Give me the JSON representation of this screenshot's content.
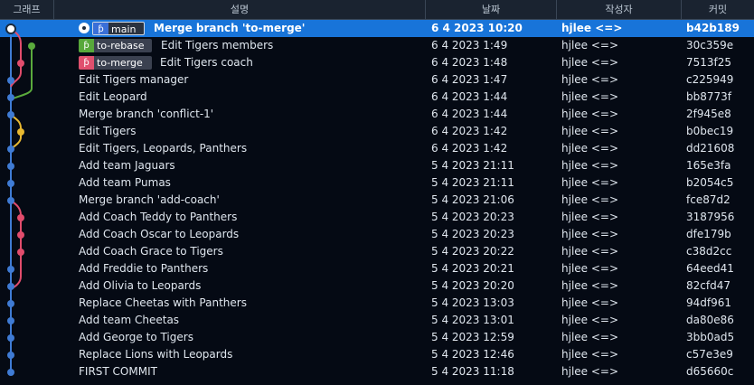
{
  "columns": {
    "graph": "그래프",
    "message": "설명",
    "date": "날짜",
    "author": "작성자",
    "commit": "커밋"
  },
  "branch_tags": {
    "main": "main",
    "to_rebase": "to-rebase",
    "to_merge": "to-merge"
  },
  "colors": {
    "lane_main": "#3f7bd4",
    "lane_rebase": "#5aaa3c",
    "lane_merge": "#e14c6c",
    "lane_conflict": "#e8b830",
    "selected_row": "#1874d9",
    "background": "#050a14"
  },
  "commits": [
    {
      "message": "Merge branch 'to-merge'",
      "date": "6 4 2023 10:20",
      "author": "hjlee <=>",
      "commit": "b42b189"
    },
    {
      "message": "Edit Tigers members",
      "date": "6 4 2023 1:49",
      "author": "hjlee <=>",
      "commit": "30c359e"
    },
    {
      "message": "Edit Tigers coach",
      "date": "6 4 2023 1:48",
      "author": "hjlee <=>",
      "commit": "7513f25"
    },
    {
      "message": "Edit Tigers manager",
      "date": "6 4 2023 1:47",
      "author": "hjlee <=>",
      "commit": "c225949"
    },
    {
      "message": "Edit Leopard",
      "date": "6 4 2023 1:44",
      "author": "hjlee <=>",
      "commit": "bb8773f"
    },
    {
      "message": "Merge branch 'conflict-1'",
      "date": "6 4 2023 1:44",
      "author": "hjlee <=>",
      "commit": "2f945e8"
    },
    {
      "message": "Edit Tigers",
      "date": "6 4 2023 1:42",
      "author": "hjlee <=>",
      "commit": "b0bec19"
    },
    {
      "message": "Edit Tigers, Leopards, Panthers",
      "date": "6 4 2023 1:42",
      "author": "hjlee <=>",
      "commit": "dd21608"
    },
    {
      "message": "Add team Jaguars",
      "date": "5 4 2023 21:11",
      "author": "hjlee <=>",
      "commit": "165e3fa"
    },
    {
      "message": "Add team Pumas",
      "date": "5 4 2023 21:11",
      "author": "hjlee <=>",
      "commit": "b2054c5"
    },
    {
      "message": "Merge branch 'add-coach'",
      "date": "5 4 2023 21:06",
      "author": "hjlee <=>",
      "commit": "fce87d2"
    },
    {
      "message": "Add Coach Teddy to Panthers",
      "date": "5 4 2023 20:23",
      "author": "hjlee <=>",
      "commit": "3187956"
    },
    {
      "message": "Add Coach Oscar to Leopards",
      "date": "5 4 2023 20:23",
      "author": "hjlee <=>",
      "commit": "dfe179b"
    },
    {
      "message": "Add Coach Grace to Tigers",
      "date": "5 4 2023 20:22",
      "author": "hjlee <=>",
      "commit": "c38d2cc"
    },
    {
      "message": "Add Freddie to Panthers",
      "date": "5 4 2023 20:21",
      "author": "hjlee <=>",
      "commit": "64eed41"
    },
    {
      "message": "Add Olivia to Leopards",
      "date": "5 4 2023 20:20",
      "author": "hjlee <=>",
      "commit": "82cfd47"
    },
    {
      "message": "Replace Cheetas with Panthers",
      "date": "5 4 2023 13:03",
      "author": "hjlee <=>",
      "commit": "94df961"
    },
    {
      "message": "Add team Cheetas",
      "date": "5 4 2023 13:01",
      "author": "hjlee <=>",
      "commit": "da80e86"
    },
    {
      "message": "Add George to Tigers",
      "date": "5 4 2023 12:59",
      "author": "hjlee <=>",
      "commit": "3bb0ad5"
    },
    {
      "message": "Replace Lions with Leopards",
      "date": "5 4 2023 12:46",
      "author": "hjlee <=>",
      "commit": "c57e3e9"
    },
    {
      "message": "FIRST COMMIT",
      "date": "5 4 2023 11:18",
      "author": "hjlee <=>",
      "commit": "d65660c"
    }
  ]
}
